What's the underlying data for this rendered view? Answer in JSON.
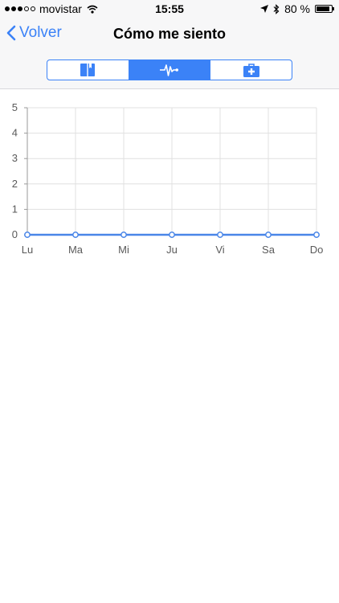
{
  "status_bar": {
    "carrier": "movistar",
    "time": "15:55",
    "battery": "80 %",
    "signal_bars_filled": 3,
    "signal_bars_total": 5,
    "icons": [
      "wifi-icon",
      "location-arrow-icon",
      "bluetooth-icon",
      "battery-icon"
    ]
  },
  "navbar": {
    "back_label": "Volver",
    "title": "Cómo me siento"
  },
  "tabs": [
    {
      "icon": "book-icon",
      "active": false
    },
    {
      "icon": "heartbeat-icon",
      "active": true
    },
    {
      "icon": "medical-kit-icon",
      "active": false
    }
  ],
  "colors": {
    "accent": "#3b82f7",
    "line": "#4a86e8",
    "grid": "#e0e0e0"
  },
  "chart_data": {
    "type": "line",
    "categories": [
      "Lu",
      "Ma",
      "Mi",
      "Ju",
      "Vi",
      "Sa",
      "Do"
    ],
    "series": [
      {
        "values": [
          0,
          0,
          0,
          0,
          0,
          0,
          0
        ]
      }
    ],
    "y_ticks": [
      "0",
      "1",
      "2",
      "3",
      "4",
      "5"
    ],
    "ylim": [
      0,
      5
    ],
    "grid": true,
    "title": "",
    "xlabel": "",
    "ylabel": ""
  }
}
